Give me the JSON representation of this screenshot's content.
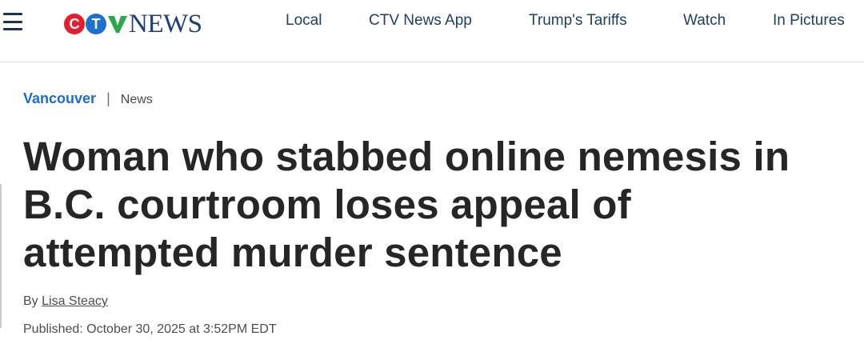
{
  "header": {
    "menu_icon": "hamburger-menu-icon",
    "logo": {
      "letters": [
        "C",
        "T",
        "V"
      ],
      "wordmark": "NEWS",
      "colors": {
        "c": "#e0202e",
        "t": "#1d6fd1",
        "v": "#2aa84a",
        "wordmark": "#1d3f7a"
      }
    },
    "nav": [
      {
        "label": "Local"
      },
      {
        "label": "CTV News App"
      },
      {
        "label": "Trump's Tariffs"
      },
      {
        "label": "Watch"
      },
      {
        "label": "In Pictures"
      }
    ]
  },
  "breadcrumb": {
    "section": "Vancouver",
    "separator": "|",
    "subsection": "News"
  },
  "article": {
    "headline": "Woman who stabbed online nemesis in B.C. courtroom loses appeal of attempted murder sentence",
    "byline_prefix": "By",
    "author": "Lisa Steacy",
    "published": "Published: October 30, 2025 at 3:52PM EDT"
  },
  "colors": {
    "link_blue": "#1a6bd6",
    "nav_text": "#1f3f66",
    "headline": "#262626"
  }
}
